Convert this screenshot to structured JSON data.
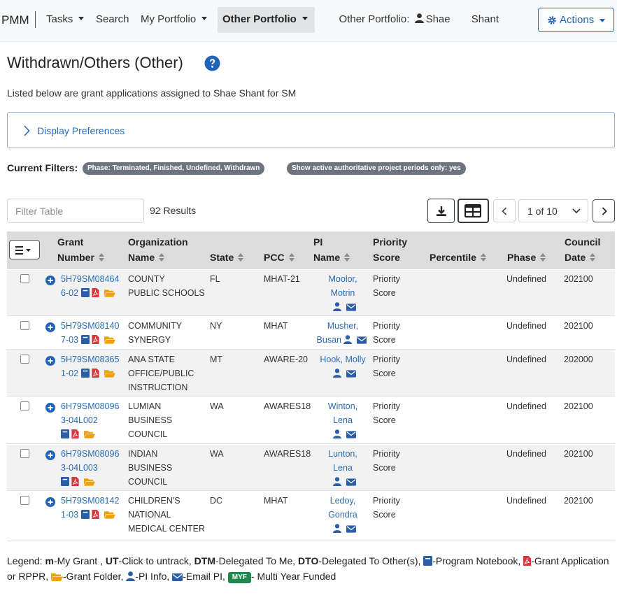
{
  "nav": {
    "brand": "PMM",
    "tasks": "Tasks",
    "search": "Search",
    "my_portfolio": "My Portfolio",
    "other_portfolio": "Other Portfolio",
    "other_portfolio_label": "Other Portfolio:",
    "user_first": "Shae",
    "user_last": "Shant",
    "actions": "Actions"
  },
  "page": {
    "title": "Withdrawn/Others (Other)",
    "subtitle": "Listed below are grant applications assigned to Shae Shant for SM",
    "display_prefs": "Display Preferences"
  },
  "filters": {
    "label": "Current Filters:",
    "badges": [
      "Phase: Terminated, Finished, Undefined, Withdrawn",
      "Show active authoritative project periods only: yes"
    ]
  },
  "toolbar": {
    "filter_placeholder": "Filter Table",
    "results": "92 Results",
    "page": "1 of 10"
  },
  "table": {
    "headers": {
      "grant_l1": "Grant",
      "grant_l2": "Number",
      "org_l1": "Organization",
      "org_l2": "Name",
      "state": "State",
      "pcc": "PCC",
      "pi_l1": "PI",
      "pi_l2": "Name",
      "priority_l1": "Priority",
      "priority_l2": "Score",
      "percentile": "Percentile",
      "phase": "Phase",
      "council_l1": "Council",
      "council_l2": "Date"
    },
    "rows": [
      {
        "grant_a": "5H79SM08464",
        "grant_b": "6-02",
        "org_a": "COUNTY",
        "org_b": "PUBLIC SCHOOLS",
        "org_c": "",
        "state": "FL",
        "pcc": "MHAT-21",
        "pi_a": "Moolor,",
        "pi_b": "Motrin",
        "priority_a": "Priority",
        "priority_b": "Score",
        "phase": "Undefined",
        "council": "202100"
      },
      {
        "grant_a": "5H79SM08140",
        "grant_b": "7-03",
        "org_a": "COMMUNITY",
        "org_b": "SYNERGY",
        "org_c": "",
        "state": "NY",
        "pcc": "MHAT",
        "pi_a": "Musher,",
        "pi_b": "Busan",
        "priority_a": "Priority",
        "priority_b": "Score",
        "phase": "Undefined",
        "council": "202100"
      },
      {
        "grant_a": "5H79SM08365",
        "grant_b": "1-02",
        "org_a": "ANA STATE",
        "org_b": "OFFICE/PUBLIC",
        "org_c": "INSTRUCTION",
        "state": "MT",
        "pcc": "AWARE-20",
        "pi_a": "Hook, Molly",
        "pi_b": "",
        "priority_a": "Priority",
        "priority_b": "Score",
        "phase": "Undefined",
        "council": "202000"
      },
      {
        "grant_a": "6H79SM08096",
        "grant_b": "3-04L002",
        "org_a": "LUMIAN",
        "org_b": "BUSINESS",
        "org_c": "COUNCIL",
        "state": "WA",
        "pcc": "AWARES18",
        "pi_a": "Winton,",
        "pi_b": "Lena",
        "priority_a": "Priority",
        "priority_b": "Score",
        "phase": "Undefined",
        "council": "202100"
      },
      {
        "grant_a": "6H79SM08096",
        "grant_b": "3-04L003",
        "org_a": "INDIAN",
        "org_b": "BUSINESS",
        "org_c": "COUNCIL",
        "state": "WA",
        "pcc": "AWARES18",
        "pi_a": "Lunton,",
        "pi_b": "Lena",
        "priority_a": "Priority",
        "priority_b": "Score",
        "phase": "Undefined",
        "council": "202100"
      },
      {
        "grant_a": "5H79SM08142",
        "grant_b": "1-03",
        "org_a": "CHILDREN'S",
        "org_b": "NATIONAL",
        "org_c": "MEDICAL CENTER",
        "state": "DC",
        "pcc": "MHAT",
        "pi_a": "Ledoy,",
        "pi_b": "Gondra",
        "priority_a": "Priority",
        "priority_b": "Score",
        "phase": "Undefined",
        "council": "202100"
      }
    ]
  },
  "legend": {
    "prefix": "Legend:",
    "m": "m",
    "m_text": "-My Grant ,",
    "ut": "UT",
    "ut_text": "-Click to untrack,",
    "dtm": "DTM",
    "dtm_text": "-Delegated To Me,",
    "dto": "DTO",
    "dto_text": "-Delegated To Other(s),",
    "notebook": "-Program Notebook,",
    "grant_app": "-Grant Application or RPPR,",
    "folder": "-Grant Folder,",
    "pi_info": "-PI Info,",
    "email": "-Email PI,",
    "myf": "MYF",
    "myf_text": "- Multi Year Funded"
  },
  "colors": {
    "link": "#2a6bb5",
    "notebook": "#2b5ea7",
    "pdf": "#d9363e",
    "folder": "#f0a10a",
    "myf": "#1f8a4c",
    "badge": "#6c757d",
    "header_bg": "#dcdcdc"
  },
  "icons": [
    "user-icon",
    "gear-icon",
    "help-icon",
    "chevron-right-icon",
    "download-icon",
    "grid-icon",
    "chevron-left-icon",
    "chevron-down-icon",
    "menu-icon",
    "plus-circle-icon",
    "notebook-icon",
    "pdf-icon",
    "folder-icon",
    "envelope-icon",
    "sort-icon"
  ]
}
